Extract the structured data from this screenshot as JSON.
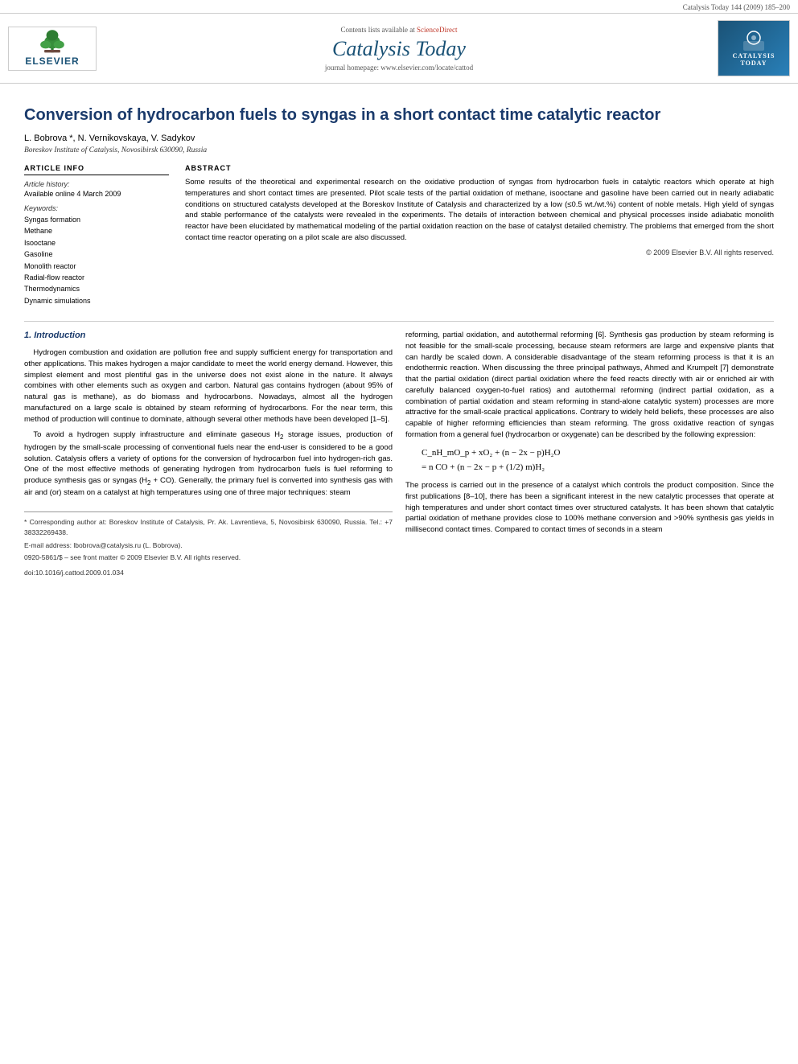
{
  "topbar": {
    "citation": "Catalysis Today 144 (2009) 185–200"
  },
  "header": {
    "contents_line": "Contents lists available at ScienceDirect",
    "sciencedirect_url": "ScienceDirect",
    "journal_title": "Catalysis Today",
    "homepage_label": "journal homepage: www.elsevier.com/locate/cattod",
    "elsevier_label": "ELSEVIER",
    "catalysis_logo_line1": "CATALYSIS",
    "catalysis_logo_line2": "TODAY"
  },
  "paper": {
    "title": "Conversion of hydrocarbon fuels to syngas in a short contact time catalytic reactor",
    "authors": "L. Bobrova *, N. Vernikovskaya, V. Sadykov",
    "affiliation": "Boreskov Institute of Catalysis, Novosibirsk 630090, Russia",
    "article_info": {
      "section_title": "ARTICLE INFO",
      "history_label": "Article history:",
      "history_value": "Available online 4 March 2009",
      "keywords_label": "Keywords:",
      "keywords": [
        "Syngas formation",
        "Methane",
        "Isooctane",
        "Gasoline",
        "Monolith reactor",
        "Radial-flow reactor",
        "Thermodynamics",
        "Dynamic simulations"
      ]
    },
    "abstract": {
      "section_title": "ABSTRACT",
      "text": "Some results of the theoretical and experimental research on the oxidative production of syngas from hydrocarbon fuels in catalytic reactors which operate at high temperatures and short contact times are presented. Pilot scale tests of the partial oxidation of methane, isooctane and gasoline have been carried out in nearly adiabatic conditions on structured catalysts developed at the Boreskov Institute of Catalysis and characterized by a low (≤0.5 wt./wt.%) content of noble metals. High yield of syngas and stable performance of the catalysts were revealed in the experiments. The details of interaction between chemical and physical processes inside adiabatic monolith reactor have been elucidated by mathematical modeling of the partial oxidation reaction on the base of catalyst detailed chemistry. The problems that emerged from the short contact time reactor operating on a pilot scale are also discussed.",
      "copyright": "© 2009 Elsevier B.V. All rights reserved."
    },
    "intro": {
      "heading": "1. Introduction",
      "col1_paragraphs": [
        "Hydrogen combustion and oxidation are pollution free and supply sufficient energy for transportation and other applications. This makes hydrogen a major candidate to meet the world energy demand. However, this simplest element and most plentiful gas in the universe does not exist alone in the nature. It always combines with other elements such as oxygen and carbon. Natural gas contains hydrogen (about 95% of natural gas is methane), as do biomass and hydrocarbons. Nowadays, almost all the hydrogen manufactured on a large scale is obtained by steam reforming of hydrocarbons. For the near term, this method of production will continue to dominate, although several other methods have been developed [1–5].",
        "To avoid a hydrogen supply infrastructure and eliminate gaseous H₂ storage issues, production of hydrogen by the small-scale processing of conventional fuels near the end-user is considered to be a good solution. Catalysis offers a variety of options for the conversion of hydrocarbon fuel into hydrogen-rich gas. One of the most effective methods of generating hydrogen from hydrocarbon fuels is fuel reforming to produce synthesis gas or syngas (H₂ + CO). Generally, the primary fuel is converted into synthesis gas with air and (or) steam on a catalyst at high temperatures using one of three major techniques: steam"
      ],
      "col2_paragraphs": [
        "reforming, partial oxidation, and autothermal reforming [6]. Synthesis gas production by steam reforming is not feasible for the small-scale processing, because steam reformers are large and expensive plants that can hardly be scaled down. A considerable disadvantage of the steam reforming process is that it is an endothermic reaction. When discussing the three principal pathways, Ahmed and Krumpelt [7] demonstrate that the partial oxidation (direct partial oxidation where the feed reacts directly with air or enriched air with carefully balanced oxygen-to-fuel ratios) and autothermal reforming (indirect partial oxidation, as a combination of partial oxidation and steam reforming in stand-alone catalytic system) processes are more attractive for the small-scale practical applications. Contrary to widely held beliefs, these processes are also capable of higher reforming efficiencies than steam reforming. The gross oxidative reaction of syngas formation from a general fuel (hydrocarbon or oxygenate) can be described by the following expression:",
        "C_nH_mO_p + xO₂ + (n − 2x − p)H₂O",
        "= n CO + (n − 2x − p + (1/2) m)H₂",
        "The process is carried out in the presence of a catalyst which controls the product composition. Since the first publications [8–10], there has been a significant interest in the new catalytic processes that operate at high temperatures and under short contact times over structured catalysts. It has been shown that catalytic partial oxidation of methane provides close to 100% methane conversion and >90% synthesis gas yields in millisecond contact times. Compared to contact times of seconds in a steam"
      ]
    },
    "footnote": {
      "corresponding_label": "* Corresponding author at: Boreskov Institute of Catalysis, Pr. Ak. Lavrentieva, 5, Novosibirsk 630090, Russia. Tel.: +7 38332269438.",
      "email_label": "E-mail address: lbobrova@catalysis.ru (L. Bobrova)."
    },
    "doi_info": {
      "issn": "0920-5861/$ – see front matter © 2009 Elsevier B.V. All rights reserved.",
      "doi": "doi:10.1016/j.cattod.2009.01.034"
    }
  }
}
